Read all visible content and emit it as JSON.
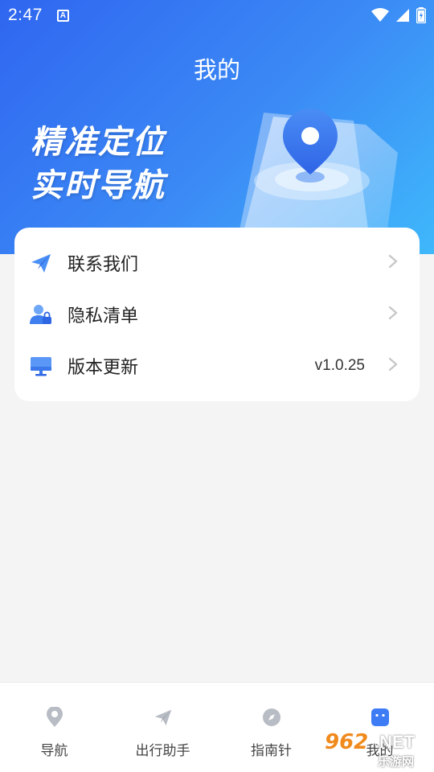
{
  "status_bar": {
    "time": "2:47",
    "notification_letter": "A"
  },
  "header": {
    "title": "我的",
    "slogan_line1": "精准定位",
    "slogan_line2": "实时导航"
  },
  "menu": {
    "items": [
      {
        "label": "联系我们",
        "icon": "paper-plane-icon",
        "value": ""
      },
      {
        "label": "隐私清单",
        "icon": "user-lock-icon",
        "value": ""
      },
      {
        "label": "版本更新",
        "icon": "monitor-icon",
        "value": "v1.0.25"
      }
    ]
  },
  "bottom_nav": {
    "active_index": 3,
    "items": [
      {
        "label": "导航",
        "icon": "location-pin-icon"
      },
      {
        "label": "出行助手",
        "icon": "paper-plane-icon"
      },
      {
        "label": "指南针",
        "icon": "compass-icon"
      },
      {
        "label": "我的",
        "icon": "profile-face-icon"
      }
    ]
  },
  "watermark": {
    "number": "962",
    "net": ".NET",
    "subtitle": "乐游网"
  },
  "colors": {
    "header_start": "#2f66f0",
    "header_end": "#3fb8fb",
    "accent": "#3d7cf5",
    "inactive_icon": "#b8bcc4",
    "background": "#f4f4f4"
  }
}
